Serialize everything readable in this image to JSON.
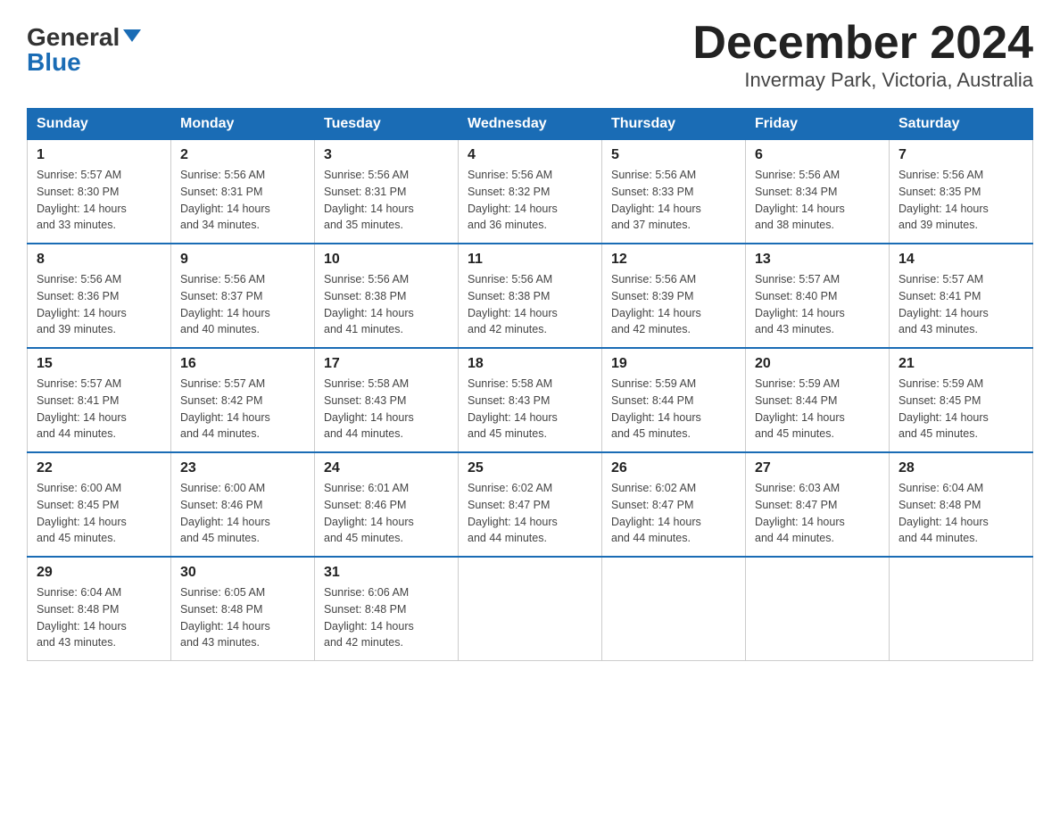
{
  "header": {
    "logo_line1": "General",
    "logo_line2": "Blue",
    "title": "December 2024",
    "subtitle": "Invermay Park, Victoria, Australia"
  },
  "days_of_week": [
    "Sunday",
    "Monday",
    "Tuesday",
    "Wednesday",
    "Thursday",
    "Friday",
    "Saturday"
  ],
  "weeks": [
    [
      {
        "day": "1",
        "sunrise": "5:57 AM",
        "sunset": "8:30 PM",
        "daylight": "14 hours and 33 minutes."
      },
      {
        "day": "2",
        "sunrise": "5:56 AM",
        "sunset": "8:31 PM",
        "daylight": "14 hours and 34 minutes."
      },
      {
        "day": "3",
        "sunrise": "5:56 AM",
        "sunset": "8:31 PM",
        "daylight": "14 hours and 35 minutes."
      },
      {
        "day": "4",
        "sunrise": "5:56 AM",
        "sunset": "8:32 PM",
        "daylight": "14 hours and 36 minutes."
      },
      {
        "day": "5",
        "sunrise": "5:56 AM",
        "sunset": "8:33 PM",
        "daylight": "14 hours and 37 minutes."
      },
      {
        "day": "6",
        "sunrise": "5:56 AM",
        "sunset": "8:34 PM",
        "daylight": "14 hours and 38 minutes."
      },
      {
        "day": "7",
        "sunrise": "5:56 AM",
        "sunset": "8:35 PM",
        "daylight": "14 hours and 39 minutes."
      }
    ],
    [
      {
        "day": "8",
        "sunrise": "5:56 AM",
        "sunset": "8:36 PM",
        "daylight": "14 hours and 39 minutes."
      },
      {
        "day": "9",
        "sunrise": "5:56 AM",
        "sunset": "8:37 PM",
        "daylight": "14 hours and 40 minutes."
      },
      {
        "day": "10",
        "sunrise": "5:56 AM",
        "sunset": "8:38 PM",
        "daylight": "14 hours and 41 minutes."
      },
      {
        "day": "11",
        "sunrise": "5:56 AM",
        "sunset": "8:38 PM",
        "daylight": "14 hours and 42 minutes."
      },
      {
        "day": "12",
        "sunrise": "5:56 AM",
        "sunset": "8:39 PM",
        "daylight": "14 hours and 42 minutes."
      },
      {
        "day": "13",
        "sunrise": "5:57 AM",
        "sunset": "8:40 PM",
        "daylight": "14 hours and 43 minutes."
      },
      {
        "day": "14",
        "sunrise": "5:57 AM",
        "sunset": "8:41 PM",
        "daylight": "14 hours and 43 minutes."
      }
    ],
    [
      {
        "day": "15",
        "sunrise": "5:57 AM",
        "sunset": "8:41 PM",
        "daylight": "14 hours and 44 minutes."
      },
      {
        "day": "16",
        "sunrise": "5:57 AM",
        "sunset": "8:42 PM",
        "daylight": "14 hours and 44 minutes."
      },
      {
        "day": "17",
        "sunrise": "5:58 AM",
        "sunset": "8:43 PM",
        "daylight": "14 hours and 44 minutes."
      },
      {
        "day": "18",
        "sunrise": "5:58 AM",
        "sunset": "8:43 PM",
        "daylight": "14 hours and 45 minutes."
      },
      {
        "day": "19",
        "sunrise": "5:59 AM",
        "sunset": "8:44 PM",
        "daylight": "14 hours and 45 minutes."
      },
      {
        "day": "20",
        "sunrise": "5:59 AM",
        "sunset": "8:44 PM",
        "daylight": "14 hours and 45 minutes."
      },
      {
        "day": "21",
        "sunrise": "5:59 AM",
        "sunset": "8:45 PM",
        "daylight": "14 hours and 45 minutes."
      }
    ],
    [
      {
        "day": "22",
        "sunrise": "6:00 AM",
        "sunset": "8:45 PM",
        "daylight": "14 hours and 45 minutes."
      },
      {
        "day": "23",
        "sunrise": "6:00 AM",
        "sunset": "8:46 PM",
        "daylight": "14 hours and 45 minutes."
      },
      {
        "day": "24",
        "sunrise": "6:01 AM",
        "sunset": "8:46 PM",
        "daylight": "14 hours and 45 minutes."
      },
      {
        "day": "25",
        "sunrise": "6:02 AM",
        "sunset": "8:47 PM",
        "daylight": "14 hours and 44 minutes."
      },
      {
        "day": "26",
        "sunrise": "6:02 AM",
        "sunset": "8:47 PM",
        "daylight": "14 hours and 44 minutes."
      },
      {
        "day": "27",
        "sunrise": "6:03 AM",
        "sunset": "8:47 PM",
        "daylight": "14 hours and 44 minutes."
      },
      {
        "day": "28",
        "sunrise": "6:04 AM",
        "sunset": "8:48 PM",
        "daylight": "14 hours and 44 minutes."
      }
    ],
    [
      {
        "day": "29",
        "sunrise": "6:04 AM",
        "sunset": "8:48 PM",
        "daylight": "14 hours and 43 minutes."
      },
      {
        "day": "30",
        "sunrise": "6:05 AM",
        "sunset": "8:48 PM",
        "daylight": "14 hours and 43 minutes."
      },
      {
        "day": "31",
        "sunrise": "6:06 AM",
        "sunset": "8:48 PM",
        "daylight": "14 hours and 42 minutes."
      },
      null,
      null,
      null,
      null
    ]
  ],
  "labels": {
    "sunrise": "Sunrise:",
    "sunset": "Sunset:",
    "daylight": "Daylight:"
  }
}
